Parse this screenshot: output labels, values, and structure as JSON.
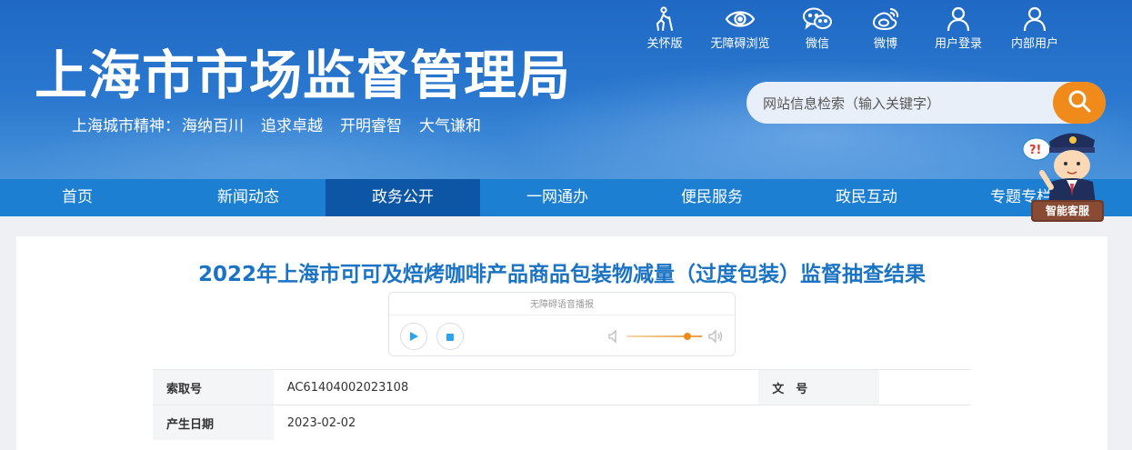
{
  "header": {
    "site_title": "上海市市场监督管理局",
    "spirit_label": "上海城市精神：",
    "spirit_items": [
      "海纳百川",
      "追求卓越",
      "开明睿智",
      "大气谦和"
    ],
    "top_links": [
      {
        "label": "关怀版",
        "icon": "elderly-care-icon"
      },
      {
        "label": "无障碍浏览",
        "icon": "eye-icon"
      },
      {
        "label": "微信",
        "icon": "wechat-icon"
      },
      {
        "label": "微博",
        "icon": "weibo-icon"
      },
      {
        "label": "用户登录",
        "icon": "user-icon"
      },
      {
        "label": "内部用户",
        "icon": "user-icon"
      }
    ],
    "search": {
      "placeholder": "网站信息检索（输入关键字）",
      "button_icon": "search-icon"
    },
    "robot_label": "智能客服"
  },
  "nav": {
    "items": [
      "首页",
      "新闻动态",
      "政务公开",
      "一网通办",
      "便民服务",
      "政民互动",
      "专题专栏"
    ],
    "active_index": 2
  },
  "article": {
    "title": "2022年上海市可可及焙烤咖啡产品商品包装物减量（过度包装）监督抽查结果",
    "player": {
      "label": "无障碍语音播报",
      "volume_level": 0.8
    },
    "meta": {
      "index_label": "索取号",
      "index_value": "AC61404002023108",
      "doc_no_label": "文　号",
      "doc_no_value": "",
      "date_label": "产生日期",
      "date_value": "2023-02-02"
    }
  },
  "colors": {
    "accent": "#1d7fd1",
    "active_nav": "#0d56a6",
    "search_button": "#f08a1a",
    "title": "#1b73c3"
  }
}
